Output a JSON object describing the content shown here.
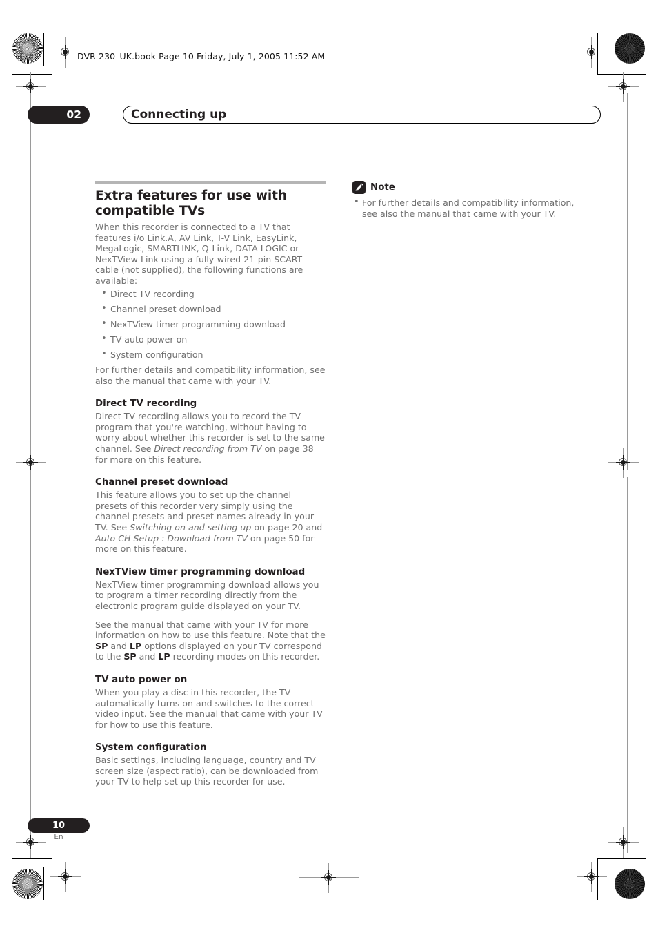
{
  "header": {
    "book_line": "DVR-230_UK.book  Page 10  Friday, July 1, 2005  11:52 AM"
  },
  "chapter": {
    "number": "02",
    "title": "Connecting up"
  },
  "left_column": {
    "main_heading": "Extra features for use with compatible TVs",
    "intro_paragraph": "When this recorder is connected to a TV that features i/o Link.A, AV Link, T-V Link, EasyLink, MegaLogic, SMARTLINK, Q-Link, DATA LOGIC or NexTView Link using a fully-wired 21-pin SCART cable (not supplied), the following functions are available:",
    "feature_bullets": [
      "Direct TV recording",
      "Channel preset download",
      "NexTView timer programming download",
      "TV auto power on",
      "System configuration"
    ],
    "closing_paragraph": "For further details and compatibility information, see also the manual that came with your TV.",
    "sections": [
      {
        "heading": "Direct TV recording",
        "text_1": "Direct TV recording allows you to record the TV program that you're watching, without having to worry about whether this recorder is set to the same channel. See ",
        "italic_1": "Direct recording from TV",
        "text_2": " on page 38 for more on this feature."
      },
      {
        "heading": "Channel preset download",
        "text_1": "This feature allows you to set up the channel presets of this recorder very simply using the channel presets and preset names already in your TV. See ",
        "italic_1": "Switching on and setting up",
        "text_2": " on page 20 and ",
        "italic_2": "Auto CH Setup : Download from TV",
        "text_3": " on page 50 for more on this feature."
      },
      {
        "heading": "NexTView timer programming download",
        "paragraph_1": "NexTView timer programming download allows you to program a timer recording directly from the electronic program guide displayed on your TV.",
        "p2_text_1": "See the manual that came with your TV for more information on how to use this feature. Note that the ",
        "p2_bold_1": "SP",
        "p2_text_2": " and ",
        "p2_bold_2": "LP",
        "p2_text_3": " options displayed on your TV correspond to the ",
        "p2_bold_3": "SP",
        "p2_text_4": " and ",
        "p2_bold_4": "LP",
        "p2_text_5": " recording modes on this recorder."
      },
      {
        "heading": "TV auto power on",
        "paragraph": "When you play a disc in this recorder, the TV automatically turns on and switches to the correct video input. See the manual that came with your TV for how to use this feature."
      },
      {
        "heading": "System configuration",
        "paragraph": "Basic settings, including language, country and TV screen size (aspect ratio), can be downloaded from your TV to help set up this recorder for use."
      }
    ]
  },
  "right_column": {
    "note_label": "Note",
    "note_icon": "pencil-note-icon",
    "note_bullets": [
      "For further details and compatibility information, see also the manual that came with your TV."
    ]
  },
  "footer": {
    "page_number": "10",
    "language_code": "En"
  },
  "colors": {
    "ink_dark": "#231f20",
    "body_text": "#6f6f6f",
    "rule_gray": "#b5b5b5"
  }
}
